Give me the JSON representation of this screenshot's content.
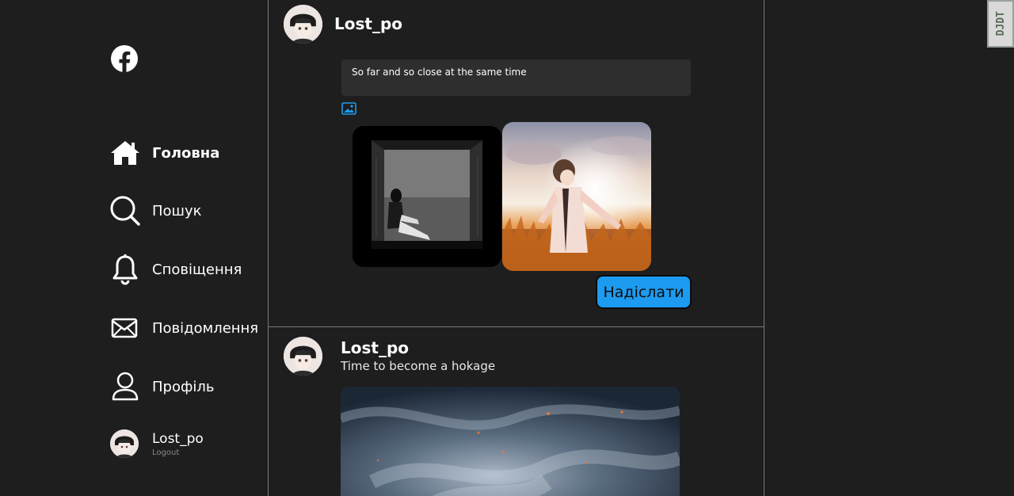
{
  "sidebar": {
    "logo_icon": "facebook-icon",
    "items": [
      {
        "label": "Головна",
        "icon": "home-icon",
        "active": true
      },
      {
        "label": "Пошук",
        "icon": "search-icon"
      },
      {
        "label": "Сповіщення",
        "icon": "bell-icon"
      },
      {
        "label": "Повідомлення",
        "icon": "envelope-icon"
      },
      {
        "label": "Профіль",
        "icon": "user-icon"
      }
    ],
    "user": {
      "name": "Lost_po",
      "logout_label": "Logout"
    }
  },
  "composer": {
    "username": "Lost_po",
    "input_value": "So far and so close at the same time",
    "image_button_icon": "image-icon",
    "send_label": "Надіслати"
  },
  "post": {
    "username": "Lost_po",
    "text": "Time to become a hokage"
  },
  "extension_badge": {
    "label": "DJDT"
  },
  "colors": {
    "background": "#1e1e1e",
    "input_background": "#2e2e2e",
    "accent": "#1d9bf0",
    "divider": "#7a7a7a"
  }
}
